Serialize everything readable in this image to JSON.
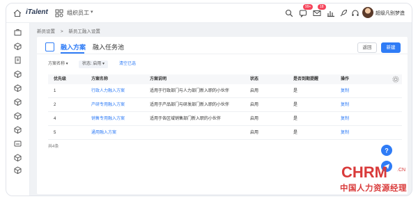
{
  "topbar": {
    "logo": "iTalent",
    "org_label": "组织员工",
    "badges": [
      "99+",
      "18"
    ],
    "user_name": "超级凡别梦造"
  },
  "breadcrumb": [
    "新员设置",
    ">",
    "新员工融入设置"
  ],
  "tabs": [
    {
      "label": "融入方案"
    },
    {
      "label": "融入任务池"
    }
  ],
  "actions": {
    "back": "返回",
    "new": "新建"
  },
  "filters": {
    "plan_name": "方案名称",
    "status": "状态: 启用",
    "clear": "清空已选"
  },
  "table": {
    "headers": [
      "优先级",
      "方案名称",
      "方案说明",
      "状态",
      "是否到期提醒",
      "操作"
    ],
    "rows": [
      {
        "priority": "1",
        "name": "行政人力融入方案",
        "desc": "适用于行政部门与人力部门新入职的小伙伴",
        "status": "启用",
        "remind": "是",
        "op": "复制"
      },
      {
        "priority": "2",
        "name": "产研专用融入方案",
        "desc": "适用于产品部门与研发部门新入职的小伙伴",
        "status": "启用",
        "remind": "是",
        "op": "复制"
      },
      {
        "priority": "4",
        "name": "销售专用融入方案",
        "desc": "适用于各区域销售部门新入职的小伙伴",
        "status": "启用",
        "remind": "是",
        "op": "复制"
      },
      {
        "priority": "5",
        "name": "通用融入方案",
        "desc": "",
        "status": "启用",
        "remind": "是",
        "op": "复制"
      }
    ],
    "total": "共4条"
  },
  "watermark": {
    "main": "CHRM",
    "cn": ".CN",
    "sub": "中国人力资源经理"
  },
  "colors": {
    "accent": "#2f7cf6",
    "watermark": "#d93a3a"
  }
}
